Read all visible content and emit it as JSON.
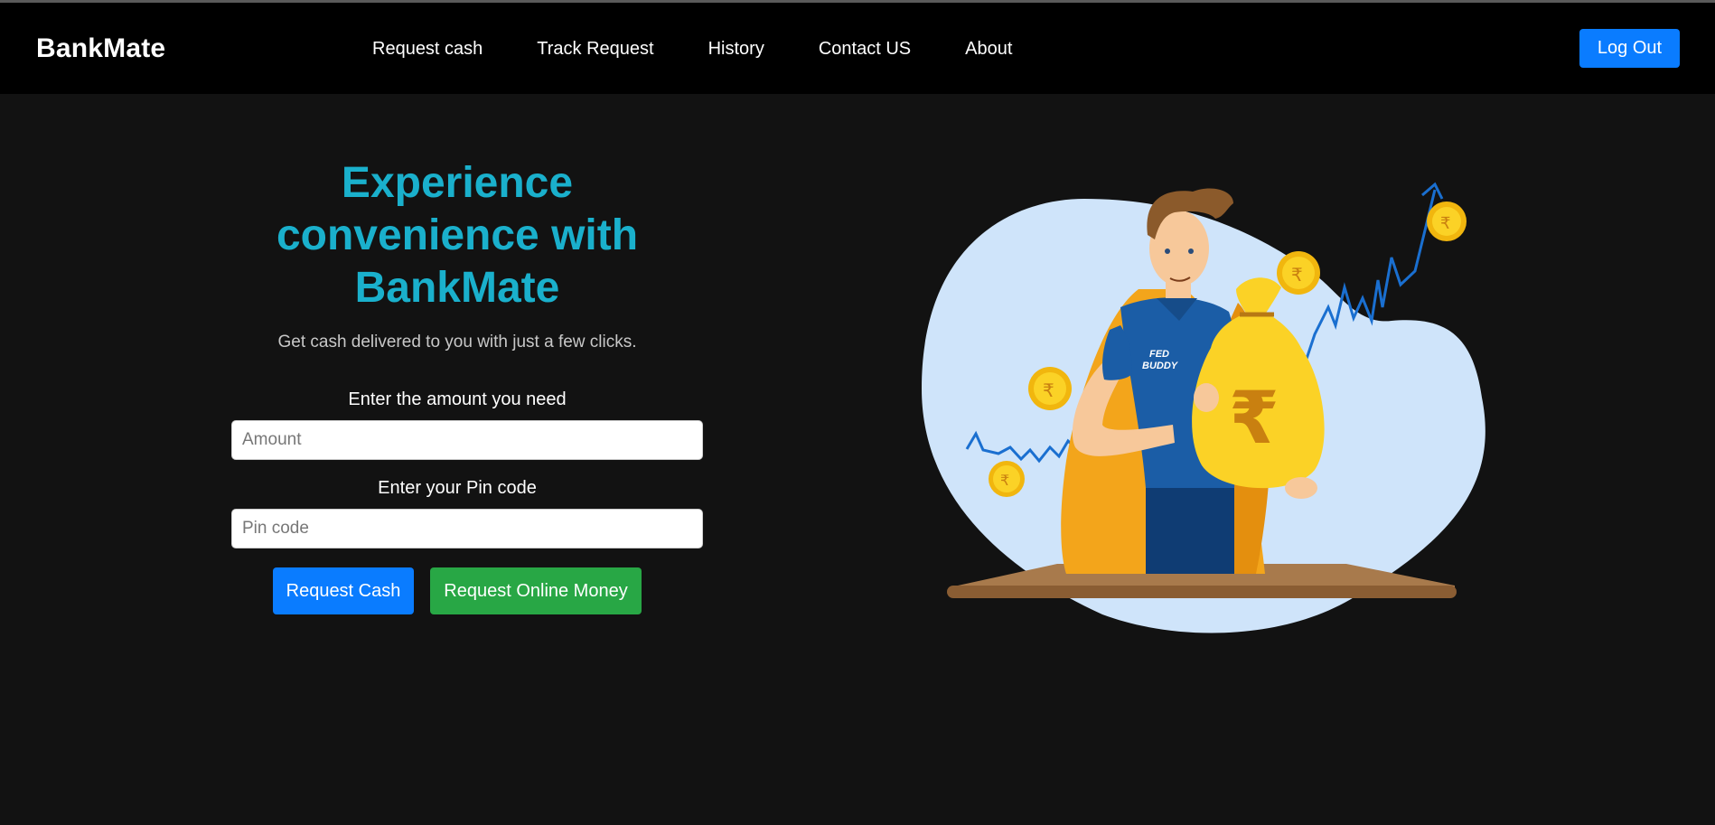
{
  "navbar": {
    "brand": "BankMate",
    "links": [
      "Request cash",
      "Track Request",
      "History",
      "Contact US",
      "About"
    ],
    "logout_label": "Log Out"
  },
  "hero": {
    "title_line1": "Experience",
    "title_line2": "convenience with",
    "title_line3": "BankMate",
    "subtitle": "Get cash delivered to you with just a few clicks."
  },
  "form": {
    "amount_label": "Enter the amount you need",
    "amount_placeholder": "Amount",
    "amount_value": "",
    "pin_label": "Enter your Pin code",
    "pin_placeholder": "Pin code",
    "pin_value": "",
    "request_cash_label": "Request Cash",
    "request_online_label": "Request Online Money"
  },
  "illustration": {
    "shirt_text_line1": "FED",
    "shirt_text_line2": "BUDDY",
    "currency_symbol": "₹"
  },
  "colors": {
    "background": "#121212",
    "navbar": "#000000",
    "accent_title": "#1ab0cc",
    "primary_button": "#0a7cff",
    "success_button": "#28a745"
  }
}
